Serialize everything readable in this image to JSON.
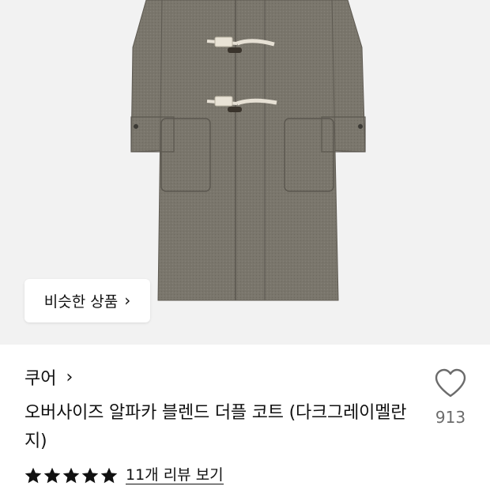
{
  "similar_button": {
    "label": "비슷한 상품",
    "chevron": "›"
  },
  "brand": {
    "name": "쿠어",
    "chevron": "›"
  },
  "product": {
    "title": "오버사이즈 알파카 블렌드 더플 코트 (다크그레이멜란지)"
  },
  "like": {
    "icon": "heart-outline-icon",
    "count": "913"
  },
  "rating": {
    "stars": 5,
    "max_stars": 5,
    "review_link": "11개 리뷰 보기"
  },
  "colors": {
    "image_background": "#f2f2f2",
    "coat": "#7a766c",
    "toggle": "#e6e0d4",
    "text": "#111111",
    "muted": "#6b6b6b"
  }
}
